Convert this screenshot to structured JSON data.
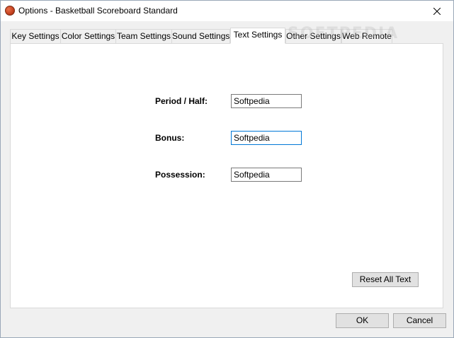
{
  "window": {
    "title": "Options - Basketball Scoreboard Standard",
    "icon": "basketball-icon"
  },
  "tabs": [
    {
      "label": "Key Settings",
      "active": false
    },
    {
      "label": "Color Settings",
      "active": false
    },
    {
      "label": "Team Settings",
      "active": false
    },
    {
      "label": "Sound Settings",
      "active": false
    },
    {
      "label": "Text Settings",
      "active": true
    },
    {
      "label": "Other Settings",
      "active": false
    },
    {
      "label": "Web Remote",
      "active": false
    }
  ],
  "text_settings": {
    "period_half": {
      "label": "Period / Half:",
      "value": "Softpedia"
    },
    "bonus": {
      "label": "Bonus:",
      "value": "Softpedia"
    },
    "possession": {
      "label": "Possession:",
      "value": "Softpedia"
    },
    "reset_button": "Reset All Text"
  },
  "footer": {
    "ok_label": "OK",
    "cancel_label": "Cancel"
  },
  "watermark": "SOFTPEDIA",
  "colors": {
    "focus_border": "#0078d7",
    "panel_bg": "#ffffff",
    "window_bg": "#f0f0f0"
  }
}
